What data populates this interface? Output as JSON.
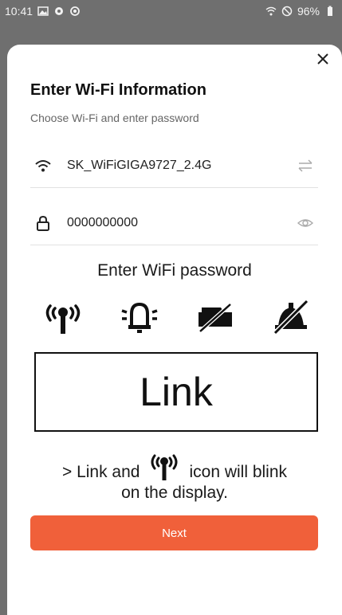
{
  "status_bar": {
    "time": "10:41",
    "battery": "96%",
    "icons_left": [
      "gallery-icon",
      "settings-icon",
      "location-icon"
    ],
    "icons_right": [
      "wifi-icon",
      "dnd-icon",
      "battery-icon"
    ]
  },
  "dialog": {
    "title": "Enter Wi-Fi Information",
    "subtitle": "Choose Wi-Fi and enter password",
    "wifi_ssid": "SK_WiFiGIGA9727_2.4G",
    "password_value": "0000000000",
    "instruction_title": "Enter WiFi password",
    "lcd_text": "Link",
    "note_prefix": "> Link and",
    "note_suffix": "icon will blink",
    "note_line2": "on the display.",
    "next_label": "Next"
  },
  "colors": {
    "accent": "#f0603a",
    "backdrop": "#6f6f6f"
  },
  "icons": {
    "wifi_field": "wifi-icon",
    "swap": "swap-arrows-icon",
    "lock": "lock-icon",
    "eye": "eye-icon",
    "close": "close-icon",
    "symbols": [
      "antenna-signal-icon",
      "alarm-bell-icon",
      "cloud-crossed-icon",
      "bell-crossed-icon"
    ]
  }
}
